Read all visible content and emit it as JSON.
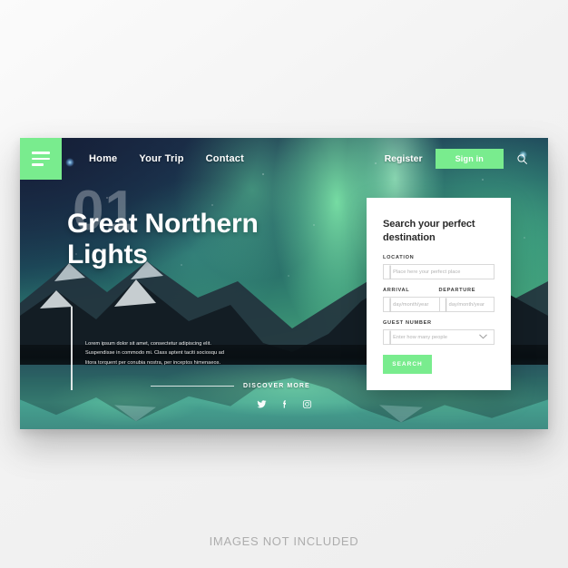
{
  "page": {
    "background_color": "#f2f2f2",
    "caption": "IMAGES NOT INCLUDED"
  },
  "theme": {
    "accent_green": "#79ec8e",
    "card_background": "#ffffff",
    "text_on_image": "#ffffff",
    "placeholder_gray": "#b2b2b2",
    "field_border": "#d9d9d9"
  },
  "nav": {
    "menu_icon": "hamburger-menu-icon",
    "links": [
      {
        "label": "Home"
      },
      {
        "label": "Your Trip"
      },
      {
        "label": "Contact"
      }
    ],
    "register_label": "Register",
    "signin_label": "Sign in",
    "search_icon": "search-icon"
  },
  "hero": {
    "number": "01",
    "title_line_1": "Great Northern",
    "title_line_2": "Lights",
    "paragraph": "Lorem ipsum dolor sit amet, consectetur adipiscing elit. Suspendisse in commodo mi. Class aptent taciti sociosqu ad litora torquent per conubia nostra, per inceptos himenaeos.",
    "discover_label": "DISCOVER MORE",
    "social": [
      {
        "name": "twitter-icon"
      },
      {
        "name": "facebook-icon"
      },
      {
        "name": "instagram-icon"
      }
    ]
  },
  "search_card": {
    "title": "Search your perfect destination",
    "location": {
      "label": "LOCATION",
      "placeholder": "Place here your perfect place",
      "value": ""
    },
    "arrival": {
      "label": "ARRIVAL",
      "placeholder": "day/month/year",
      "value": ""
    },
    "departure": {
      "label": "DEPARTURE",
      "placeholder": "day/month/year",
      "value": ""
    },
    "guest_number": {
      "label": "GUEST NUMBER",
      "placeholder": "Enter how many people",
      "value": "",
      "chevron_icon": "chevron-down-icon"
    },
    "submit_label": "SEARCH"
  }
}
